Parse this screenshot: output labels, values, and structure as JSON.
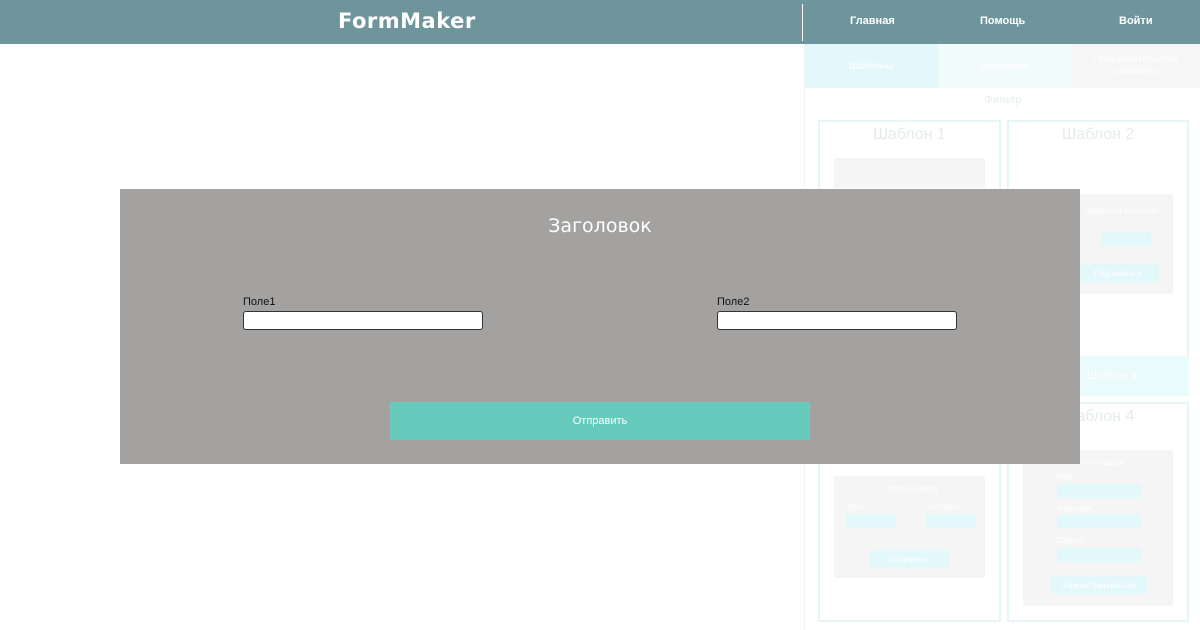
{
  "header": {
    "logo": "FormMaker",
    "nav": {
      "main": "Главная",
      "help": "Помощь",
      "login": "Войти"
    }
  },
  "side": {
    "tabs": [
      "Шаблоны",
      "Настройки",
      "Пользовательские шаблоны"
    ],
    "filter": "Фильтр",
    "cards": [
      {
        "title": "Шаблон 1"
      },
      {
        "title": "Шаблон 2",
        "mini_title": "Заявка на рассылку",
        "mini_button": "Подписаться"
      },
      {
        "band": "Шаблон 3"
      },
      {
        "title": "Шаблон 4",
        "mini_title": "Регистрация",
        "fields": [
          "Имя",
          "Фамилия",
          "Пароль"
        ],
        "mini_button": "Зарегистрироваться"
      },
      {
        "mini_title": "Форма заказа",
        "fields": [
          "Имя",
          "Телефон"
        ],
        "mini_button": "Отправить"
      }
    ]
  },
  "modal": {
    "title": "Заголовок",
    "field1": {
      "label": "Поле1",
      "value": ""
    },
    "field2": {
      "label": "Поле2",
      "value": ""
    },
    "submit": "Отправить"
  }
}
